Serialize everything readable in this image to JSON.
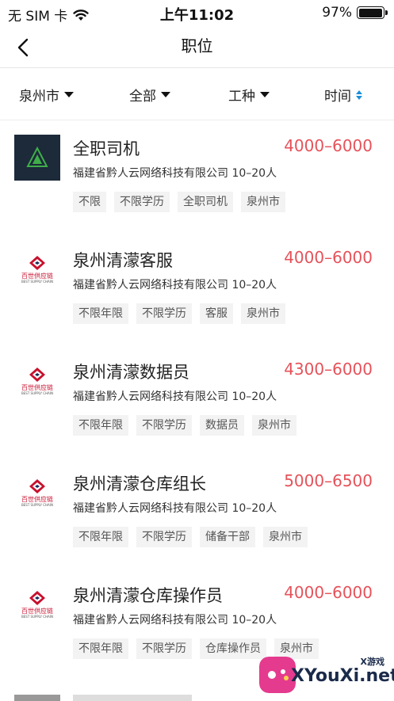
{
  "status_bar": {
    "carrier": "无 SIM 卡",
    "time": "上午11:02",
    "battery": "97%",
    "battery_level": 0.97
  },
  "nav": {
    "title": "职位"
  },
  "filters": [
    {
      "label": "泉州市"
    },
    {
      "label": "全部"
    },
    {
      "label": "工种"
    },
    {
      "label": "时间"
    }
  ],
  "jobs": [
    {
      "title": "全职司机",
      "salary": "4000–6000",
      "company": "福建省黔人云网络科技有限公司 10–20人",
      "tags": [
        "不限",
        "不限学历",
        "全职司机",
        "泉州市"
      ],
      "logo": "dark"
    },
    {
      "title": "泉州清濛客服",
      "salary": "4000–6000",
      "company": "福建省黔人云网络科技有限公司 10–20人",
      "tags": [
        "不限年限",
        "不限学历",
        "客服",
        "泉州市"
      ],
      "logo": "light"
    },
    {
      "title": "泉州清濛数据员",
      "salary": "4300–6000",
      "company": "福建省黔人云网络科技有限公司 10–20人",
      "tags": [
        "不限年限",
        "不限学历",
        "数据员",
        "泉州市"
      ],
      "logo": "light"
    },
    {
      "title": "泉州清濛仓库组长",
      "salary": "5000–6500",
      "company": "福建省黔人云网络科技有限公司 10–20人",
      "tags": [
        "不限年限",
        "不限学历",
        "储备干部",
        "泉州市"
      ],
      "logo": "light"
    },
    {
      "title": "泉州清濛仓库操作员",
      "salary": "4000–6000",
      "company": "福建省黔人云网络科技有限公司 10–20人",
      "tags": [
        "不限年限",
        "不限学历",
        "仓库操作员",
        "泉州市"
      ],
      "logo": "light"
    }
  ],
  "logo_text": {
    "brand": "百世供应链",
    "brand_sub": "BEST SUPPLY CHAIN"
  },
  "watermark": {
    "big": "XYouXi.net",
    "small": "X游戏"
  },
  "colors": {
    "salary": "#e6525a",
    "tag_bg": "#f3f3f3",
    "sort_accent": "#1a8fd8"
  }
}
